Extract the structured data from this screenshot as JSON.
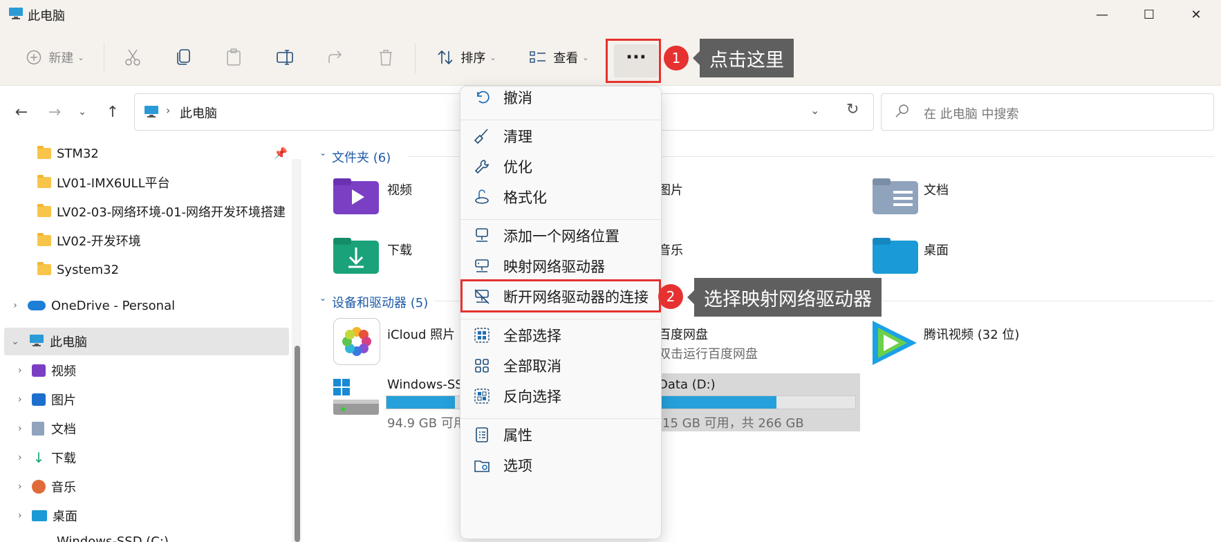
{
  "window": {
    "title": "此电脑"
  },
  "toolbar": {
    "new_label": "新建",
    "sort_label": "排序",
    "view_label": "查看"
  },
  "address": {
    "crumb": "此电脑",
    "search_placeholder": "在 此电脑 中搜索"
  },
  "nav": {
    "quick_items": [
      "STM32",
      "LV01-IMX6ULL平台",
      "LV02-03-网络环境-01-网络开发环境搭建",
      "LV02-开发环境",
      "System32"
    ],
    "onedrive": "OneDrive - Personal",
    "this_pc": "此电脑",
    "pc_items": [
      "视频",
      "图片",
      "文档",
      "下载",
      "音乐",
      "桌面"
    ],
    "cut_item": "Windows-SSD (C:)"
  },
  "content": {
    "folders_title": "文件夹 (6)",
    "folders": [
      "视频",
      "图片",
      "文档",
      "下载",
      "音乐",
      "桌面"
    ],
    "devices_title": "设备和驱动器 (5)",
    "devices": {
      "icloud": "iCloud 照片",
      "baidu": "百度网盘",
      "baidu_sub": "双击运行百度网盘",
      "tencent": "腾讯视频 (32 位)",
      "c_drive": "Windows-SS",
      "c_drive_free": "94.9 GB 可用",
      "c_used_fraction": 0.88,
      "d_drive": "Data (D:)",
      "d_drive_free": "15 GB 可用，共 266 GB",
      "d_used_fraction": 0.6
    }
  },
  "menu": {
    "items": [
      {
        "label": "撤消",
        "icon": "undo-icon"
      },
      {
        "label": "清理",
        "icon": "broom-icon"
      },
      {
        "label": "优化",
        "icon": "wrench-icon"
      },
      {
        "label": "格式化",
        "icon": "format-icon"
      },
      {
        "label": "添加一个网络位置",
        "icon": "network-location-icon"
      },
      {
        "label": "映射网络驱动器",
        "icon": "map-drive-icon"
      },
      {
        "label": "断开网络驱动器的连接",
        "icon": "disconnect-drive-icon"
      },
      {
        "label": "全部选择",
        "icon": "select-all-icon"
      },
      {
        "label": "全部取消",
        "icon": "select-none-icon"
      },
      {
        "label": "反向选择",
        "icon": "invert-selection-icon"
      },
      {
        "label": "属性",
        "icon": "properties-icon"
      },
      {
        "label": "选项",
        "icon": "options-icon"
      }
    ]
  },
  "annotations": {
    "step1_number": "1",
    "step1_text": "点击这里",
    "step2_number": "2",
    "step2_text": "选择映射网络驱动器"
  },
  "colors": {
    "accent": "#1e5aa8",
    "annotation_red": "#e5312f",
    "callout_bg": "#5f5f5f"
  }
}
